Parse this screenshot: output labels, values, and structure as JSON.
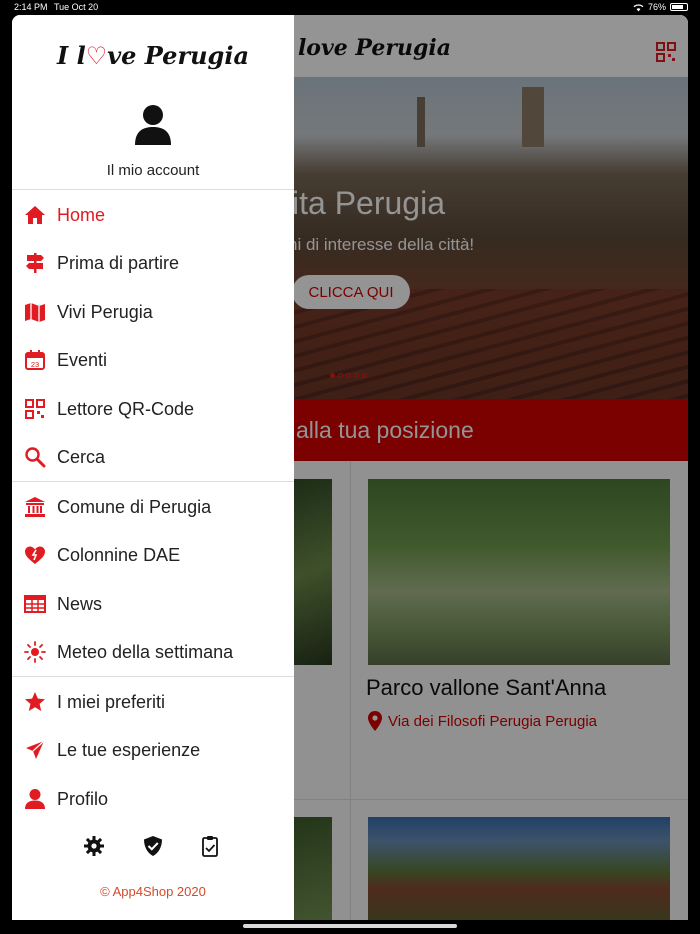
{
  "status_bar": {
    "time": "2:14 PM",
    "date": "Tue Oct 20",
    "battery": "76%"
  },
  "background_app": {
    "logo": "I love Perugia",
    "hero": {
      "title": "ita Perugia",
      "subtitle": "hi di interesse della città!",
      "button": "CLICCA QUI",
      "slides": 5,
      "active_slide": 0
    },
    "position_bar": "alla tua posizione",
    "card": {
      "title": "Parco vallone Sant'Anna",
      "address": "Via dei Filosofi Perugia Perugia"
    }
  },
  "drawer": {
    "logo": {
      "pre": "I l",
      "post": "ve Perugia"
    },
    "account_label": "Il mio account",
    "accent_color": "#e01b22",
    "groups": [
      [
        {
          "label": "Home",
          "icon": "home-icon",
          "active": true
        },
        {
          "label": "Prima di partire",
          "icon": "signpost-icon",
          "active": false
        },
        {
          "label": "Vivi Perugia",
          "icon": "map-icon",
          "active": false
        },
        {
          "label": "Eventi",
          "icon": "calendar-icon",
          "active": false
        },
        {
          "label": "Lettore QR-Code",
          "icon": "qr-code-icon",
          "active": false
        },
        {
          "label": "Cerca",
          "icon": "search-icon",
          "active": false
        }
      ],
      [
        {
          "label": "Comune di Perugia",
          "icon": "institution-icon",
          "active": false
        },
        {
          "label": "Colonnine DAE",
          "icon": "heart-pulse-icon",
          "active": false
        },
        {
          "label": "News",
          "icon": "newspaper-icon",
          "active": false
        },
        {
          "label": "Meteo della settimana",
          "icon": "sun-icon",
          "active": false
        }
      ],
      [
        {
          "label": "I miei preferiti",
          "icon": "star-icon",
          "active": false
        },
        {
          "label": "Le tue esperienze",
          "icon": "paper-plane-icon",
          "active": false
        },
        {
          "label": "Profilo",
          "icon": "user-icon",
          "active": false
        }
      ]
    ],
    "footer_icons": [
      "gear-icon",
      "shield-check-icon",
      "clipboard-check-icon"
    ],
    "copyright": "© App4Shop 2020"
  }
}
